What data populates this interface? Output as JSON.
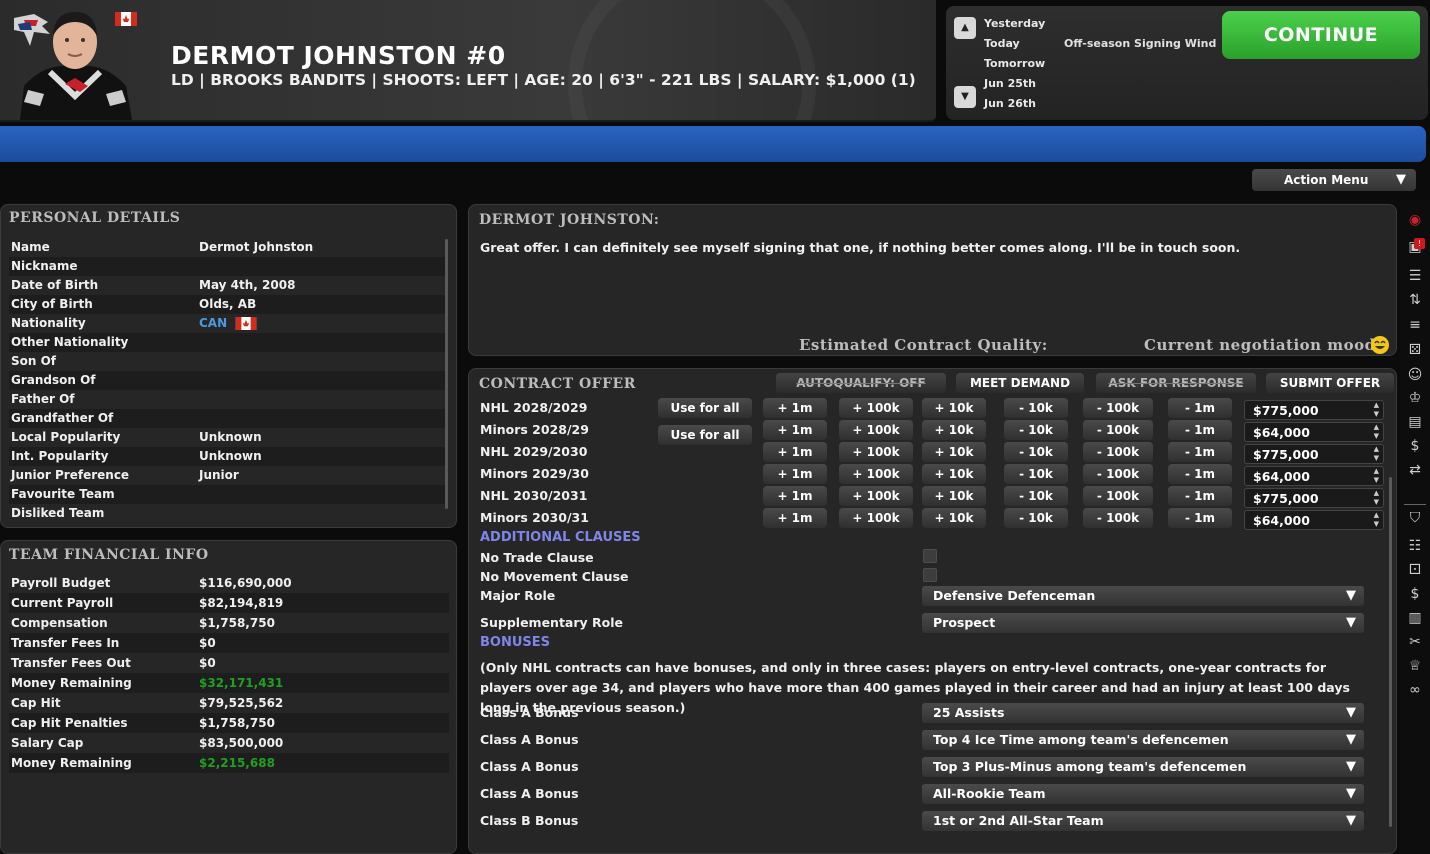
{
  "header": {
    "player_name": "DERMOT JOHNSTON #0",
    "player_info": "LD | BROOKS BANDITS | SHOOTS: LEFT | AGE: 20 | 6'3\" - 221 LBS | SALARY: $1,000 (1)"
  },
  "calendar": {
    "dates": [
      "Yesterday",
      "Today",
      "Tomorrow",
      "Jun 25th",
      "Jun 26th"
    ],
    "message": "Off-season Signing Window Be",
    "continue_label": "CONTINUE"
  },
  "action_menu_label": "Action Menu",
  "personal": {
    "title": "PERSONAL DETAILS",
    "rows": [
      {
        "label": "Name",
        "value": "Dermot Johnston"
      },
      {
        "label": "Nickname",
        "value": ""
      },
      {
        "label": "Date of Birth",
        "value": "May 4th, 2008"
      },
      {
        "label": "City of Birth",
        "value": "Olds, AB"
      },
      {
        "label": "Nationality",
        "value": "CAN"
      },
      {
        "label": "Other Nationality",
        "value": ""
      },
      {
        "label": "Son Of",
        "value": ""
      },
      {
        "label": "Grandson Of",
        "value": ""
      },
      {
        "label": "Father Of",
        "value": ""
      },
      {
        "label": "Grandfather Of",
        "value": ""
      },
      {
        "label": "Local Popularity",
        "value": "Unknown"
      },
      {
        "label": "Int. Popularity",
        "value": "Unknown"
      },
      {
        "label": "Junior Preference",
        "value": "Junior"
      },
      {
        "label": "Favourite Team",
        "value": ""
      },
      {
        "label": "Disliked Team",
        "value": ""
      }
    ]
  },
  "financial": {
    "title": "TEAM FINANCIAL INFO",
    "rows": [
      {
        "label": "Payroll Budget",
        "value": "$116,690,000"
      },
      {
        "label": "Current Payroll",
        "value": "$82,194,819"
      },
      {
        "label": "Compensation",
        "value": "$1,758,750"
      },
      {
        "label": "Transfer Fees In",
        "value": "$0"
      },
      {
        "label": "Transfer Fees Out",
        "value": "$0"
      },
      {
        "label": "Money Remaining",
        "value": "$32,171,431"
      },
      {
        "label": "Cap Hit",
        "value": "$79,525,562"
      },
      {
        "label": "Cap Hit Penalties",
        "value": "$1,758,750"
      },
      {
        "label": "Salary Cap",
        "value": "$83,500,000"
      },
      {
        "label": "Money Remaining",
        "value": "$2,215,688"
      }
    ]
  },
  "negotiation": {
    "title": "DERMOT JOHNSTON:",
    "message": "Great offer. I can definitely see myself signing that one, if nothing better comes along. I'll be in touch soon.",
    "quality_label": "Estimated Contract Quality:",
    "mood_label": "Current negotiation mood:"
  },
  "contract": {
    "title": "CONTRACT OFFER",
    "buttons": {
      "autoqualify": "AUTOQUALIFY: OFF",
      "meet_demand": "MEET DEMAND",
      "ask": "ASK FOR RESPONSE",
      "submit": "SUBMIT OFFER",
      "use_for_all": "Use for all"
    },
    "step_labels": [
      "+ 1m",
      "+ 100k",
      "+ 10k",
      "- 10k",
      "- 100k",
      "- 1m"
    ],
    "years": [
      {
        "label": "NHL 2028/2029",
        "amount": "$775,000"
      },
      {
        "label": "Minors 2028/29",
        "amount": "$64,000"
      },
      {
        "label": "NHL 2029/2030",
        "amount": "$775,000"
      },
      {
        "label": "Minors 2029/30",
        "amount": "$64,000"
      },
      {
        "label": "NHL 2030/2031",
        "amount": "$775,000"
      },
      {
        "label": "Minors 2030/31",
        "amount": "$64,000"
      }
    ],
    "additional_title": "ADDITIONAL CLAUSES",
    "no_trade": "No Trade Clause",
    "no_movement": "No Movement Clause",
    "major_role_label": "Major Role",
    "major_role_value": "Defensive Defenceman",
    "supp_role_label": "Supplementary Role",
    "supp_role_value": "Prospect",
    "bonuses_title": "BONUSES",
    "bonuses_note": "(Only NHL contracts can have bonuses, and only in three cases: players on entry-level contracts, one-year contracts for players over age 34, and players who have more than 400 games played in their career and had an injury at least 100 days long in the previous season.)",
    "bonuses": [
      {
        "label": "Class A Bonus",
        "value": "25 Assists"
      },
      {
        "label": "Class A Bonus",
        "value": "Top 4 Ice Time among team's defencemen"
      },
      {
        "label": "Class A Bonus",
        "value": "Top 3 Plus-Minus among team's defencemen"
      },
      {
        "label": "Class A Bonus",
        "value": "All-Rookie Team"
      },
      {
        "label": "Class B Bonus",
        "value": "1st or 2nd All-Star Team"
      }
    ]
  },
  "colors": {
    "accent_blue": "#2a63c2",
    "continue_green": "#3bbf3b",
    "money_green": "#1fa01f",
    "section_purple": "#7f86e8"
  }
}
